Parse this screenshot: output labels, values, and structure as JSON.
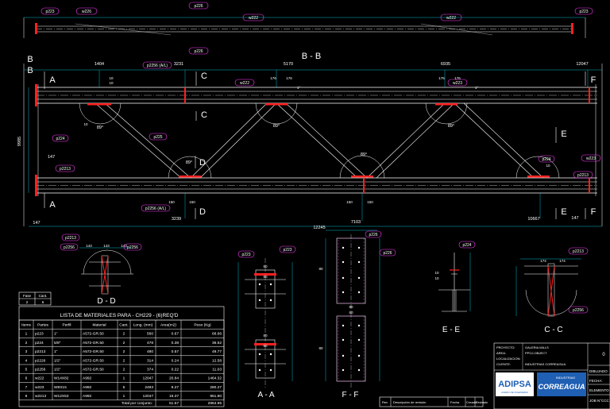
{
  "colors": {
    "background": "#000000",
    "line": "#ffffff",
    "part_tag": "#ff3cff",
    "dimension": "#00e5ff",
    "weld": "#ff2020",
    "title_block": "#ffffff",
    "logo_blue": "#1f5fb4"
  },
  "top_view": {
    "tags": [
      "p223",
      "w226",
      "p226",
      "w222",
      "p226",
      "w222",
      "p223"
    ]
  },
  "elevation": {
    "title": "B - B",
    "dims_top": [
      "1404",
      "3231",
      "5170",
      "6935",
      "12047"
    ],
    "dims_left": [
      "9985",
      "147",
      "147"
    ],
    "dims_bottom": [
      "3239",
      "7103",
      "10667",
      "147"
    ],
    "angles": [
      "89°",
      "89°",
      "89°",
      "89°",
      "89°"
    ],
    "tags": [
      "p2256 (A/L)",
      "p224",
      "p2213",
      "p2256 (A/L)",
      "w222",
      "w223",
      "p225",
      "p2213",
      "p224",
      "w223"
    ],
    "section_marks": {
      "A": "A",
      "B": "B",
      "C": "C",
      "D": "D",
      "E": "E",
      "F": "F"
    },
    "small_dims": [
      "176",
      "176",
      "176",
      "176",
      "150",
      "150",
      "150",
      "150",
      "10",
      "10",
      "10",
      "10",
      "1°",
      "1°"
    ]
  },
  "section_dd": {
    "label": "D - D",
    "dims": [
      "143",
      "143",
      "143"
    ],
    "tags": [
      "p2213",
      "p2256",
      "p2256"
    ]
  },
  "section_aa": {
    "label": "A - A",
    "dims": [
      "80",
      "80",
      "80",
      "80"
    ],
    "tags": [
      "p223",
      "p223"
    ]
  },
  "section_ff": {
    "label": "F - F",
    "top_dim": "12245",
    "dims": [
      "80",
      "80",
      "80",
      "80"
    ],
    "tags": [
      "p226",
      "p226"
    ]
  },
  "section_ee": {
    "label": "E - E",
    "tags": [
      "p224"
    ],
    "dims": [
      "10",
      "10"
    ]
  },
  "section_cc": {
    "label": "C - C",
    "dims": [
      "174",
      "174"
    ],
    "tags": [
      "p2213",
      "p2256"
    ]
  },
  "fase": {
    "headers": [
      "Fase",
      "Cant."
    ],
    "values": [
      "2",
      "6"
    ]
  },
  "materials": {
    "title": "LISTA DE MATERIALES PARA - CH229 - (6)REQ'D",
    "headers": [
      "Items",
      "Partes",
      "Perfil",
      "Material",
      "Cant.",
      "Long. (mm)",
      "Area(m2)",
      "Peso (Kg)"
    ],
    "rows": [
      [
        "1",
        "p223",
        "1\"",
        "A572-GR.50",
        "2",
        "560",
        "0.67",
        "68.66"
      ],
      [
        "2",
        "p224",
        "5/8\"",
        "A572-GR.50",
        "2",
        "478",
        "0.38",
        "36.52"
      ],
      [
        "3",
        "p2213",
        "1\"",
        "A572-GR.50",
        "2",
        "480",
        "0.57",
        "49.77"
      ],
      [
        "4",
        "p2226",
        "1/2\"",
        "A572-GR.50",
        "2",
        "314",
        "0.24",
        "12.58"
      ],
      [
        "5",
        "p2256",
        "1/2\"",
        "A572-GR.50",
        "2",
        "374",
        "0.22",
        "11.03"
      ],
      [
        "6",
        "w222",
        "W14X82",
        "A992",
        "1",
        "12047",
        "20.84",
        "1464.32"
      ],
      [
        "7",
        "w223",
        "W8X15",
        "A992",
        "5",
        "2493",
        "9.27",
        "280.27"
      ],
      [
        "8",
        "w2213",
        "W12X53",
        "A992",
        "1",
        "12047",
        "19.37",
        "951.80"
      ]
    ],
    "total_label": "Total por conjunto:",
    "total_area": "51.57",
    "total_weight": "2864.95"
  },
  "revision": {
    "headers": [
      "Rev",
      "Descripción de revisión",
      "Fecha",
      "Creado",
      "Revisado"
    ]
  },
  "title_block": {
    "labels": [
      "PROYECTO:",
      "AREA:",
      "LOCALIZACION:",
      "CLIENTE:"
    ],
    "values": [
      "GALERIA MILLS",
      "PPOJ-OBJECT",
      "",
      "INDUSTRIAS CORREAGUA"
    ],
    "right_labels": [
      "DIBUJADO",
      "FECHA:",
      "ELEMENTO",
      "JOB N°CCC"
    ],
    "sheet": "0",
    "logo_left": "ADIPSA",
    "logo_left_sub": "ACERO DE INGENIERIA",
    "logo_right_top": "INDUSTRIAS",
    "logo_right": "CORREAGUA"
  }
}
